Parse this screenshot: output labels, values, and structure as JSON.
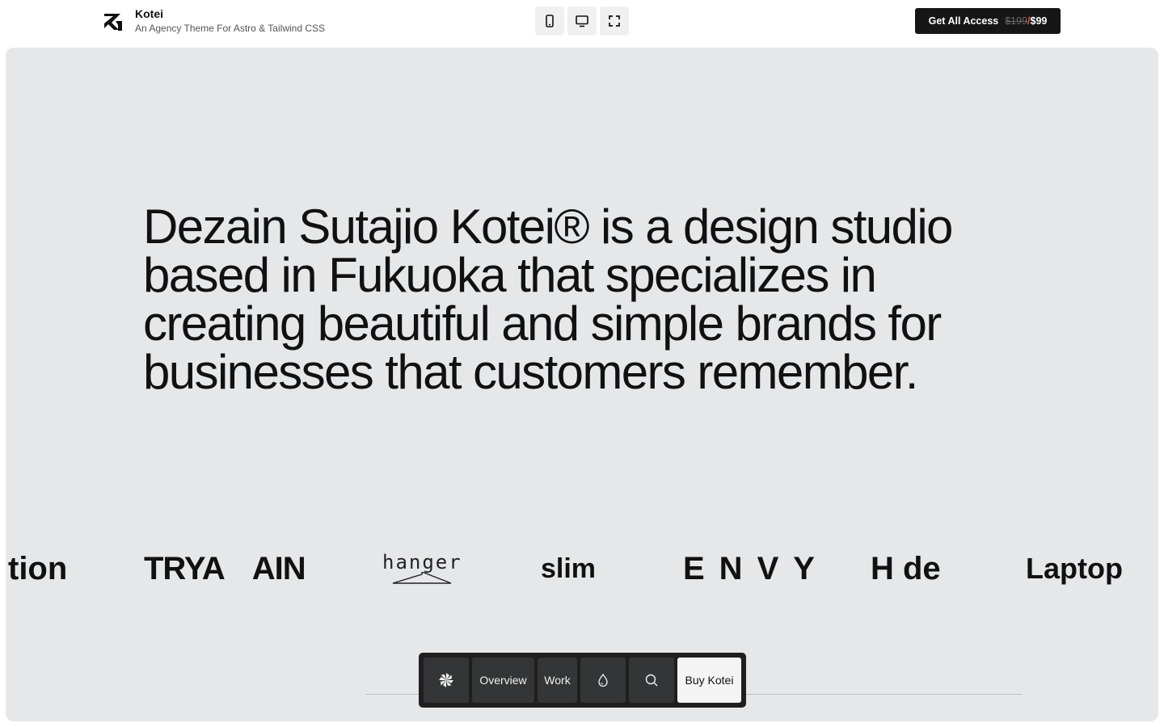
{
  "header": {
    "brand_name": "Kotei",
    "brand_tagline": "An Agency Theme For Astro & Tailwind CSS",
    "device_buttons": [
      {
        "name": "mobile-view",
        "icon": "mobile-icon"
      },
      {
        "name": "desktop-view",
        "icon": "desktop-icon"
      },
      {
        "name": "fullscreen-view",
        "icon": "fullscreen-icon"
      }
    ],
    "cta": {
      "label": "Get All Access",
      "old_price": "$199",
      "separator": "/",
      "new_price": "$99"
    }
  },
  "hero": {
    "text": "Dezain Sutajio Kotei® is a design studio based in Fukuoka that specializes in creating beautiful and simple brands for businesses that customers remember."
  },
  "logos": {
    "items": [
      "tion",
      "TRYA",
      "AIN",
      "hanger",
      "slim",
      "ENVY",
      "H de",
      "Laptop"
    ]
  },
  "bottom_nav": {
    "items": [
      {
        "label": "",
        "icon": "pinwheel-logo-icon"
      },
      {
        "label": "Overview"
      },
      {
        "label": "Work"
      },
      {
        "label": "",
        "icon": "droplet-icon"
      },
      {
        "label": "",
        "icon": "search-icon"
      },
      {
        "label": "Buy Kotei"
      }
    ]
  },
  "colors": {
    "frame_bg": "#e6e7e9",
    "nav_bg": "#1f1f20",
    "nav_item_bg": "#343536",
    "cta_bg": "#161616"
  }
}
